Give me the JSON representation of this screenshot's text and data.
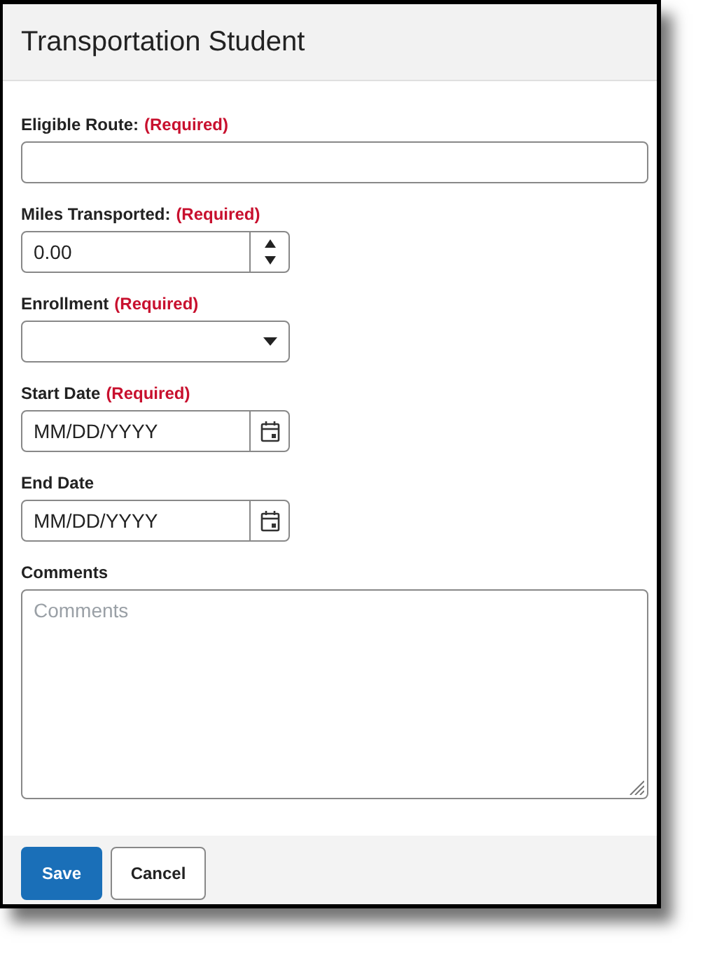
{
  "window": {
    "title": "Transportation Student"
  },
  "fields": [
    {
      "kind": "text",
      "label": "Eligible Route:",
      "required_note": "(Required)"
    },
    {
      "kind": "number",
      "label": "Miles Transported:",
      "required_note": "(Required)",
      "value": "0.00"
    },
    {
      "kind": "select",
      "label": "Enrollment",
      "required_note": "(Required)"
    },
    {
      "kind": "date",
      "label": "Start Date",
      "required_note": "(Required)",
      "placeholder": "MM/DD/YYYY"
    },
    {
      "kind": "date",
      "label": "End Date",
      "placeholder": "MM/DD/YYYY"
    },
    {
      "kind": "textarea",
      "label": "Comments",
      "placeholder": "Comments"
    }
  ],
  "buttons": [
    {
      "kind": "primary",
      "label": "Save"
    },
    {
      "kind": "secondary",
      "label": "Cancel"
    }
  ]
}
